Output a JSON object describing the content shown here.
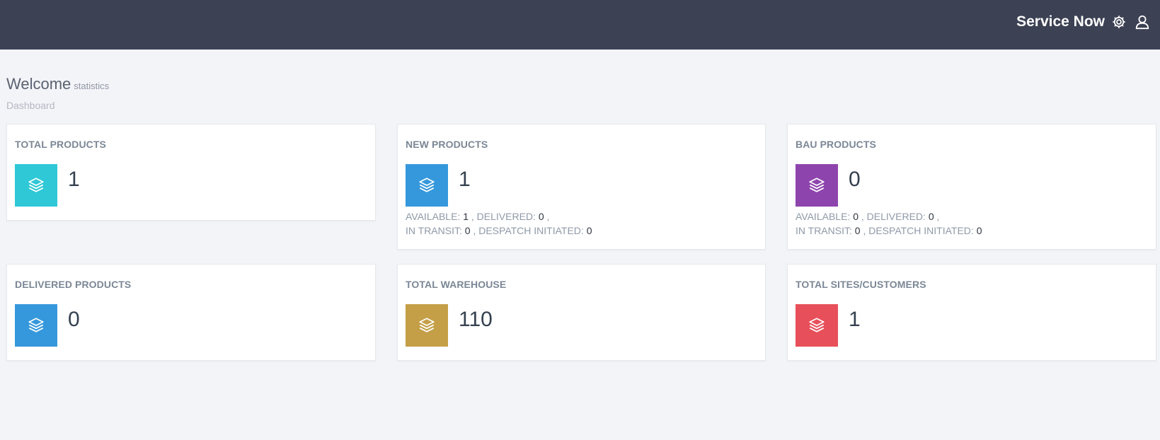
{
  "header": {
    "brand": "Service Now",
    "settings_icon": "gear-icon",
    "user_icon": "user-icon"
  },
  "page": {
    "title": "Welcome",
    "subtitle": "statistics",
    "breadcrumb": "Dashboard"
  },
  "cards": [
    {
      "title": "TOTAL PRODUCTS",
      "value": "1",
      "color": "#2ec8d6",
      "icon": "layers-icon"
    },
    {
      "title": "NEW PRODUCTS",
      "value": "1",
      "color": "#3598dc",
      "icon": "layers-icon",
      "stats": {
        "available_label": "AVAILABLE:",
        "available": "1",
        "delivered_label": "DELIVERED:",
        "delivered": "0",
        "transit_label": "IN TRANSIT:",
        "transit": "0",
        "despatch_label": "DESPATCH INITIATED:",
        "despatch": "0"
      }
    },
    {
      "title": "BAU PRODUCTS",
      "value": "0",
      "color": "#8e44ad",
      "icon": "layers-icon",
      "stats": {
        "available_label": "AVAILABLE:",
        "available": "0",
        "delivered_label": "DELIVERED:",
        "delivered": "0",
        "transit_label": "IN TRANSIT:",
        "transit": "0",
        "despatch_label": "DESPATCH INITIATED:",
        "despatch": "0"
      }
    },
    {
      "title": "DELIVERED PRODUCTS",
      "value": "0",
      "color": "#3598dc",
      "icon": "layers-icon"
    },
    {
      "title": "TOTAL WAREHOUSE",
      "value": "110",
      "color": "#c49f47",
      "icon": "layers-icon"
    },
    {
      "title": "TOTAL SITES/CUSTOMERS",
      "value": "1",
      "color": "#e7505a",
      "icon": "layers-icon"
    }
  ]
}
